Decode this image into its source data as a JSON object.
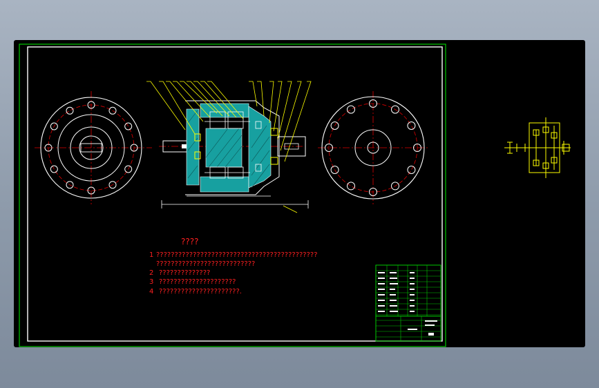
{
  "viewport": {
    "background": "#000000",
    "frame_color": "#00c800",
    "outer_frame_color": "#ffffff"
  },
  "colors": {
    "outline": "#ffffff",
    "centerline": "#e00000",
    "leader": "#ffff00",
    "section_fill": "#17a0a0",
    "notes": "#ff2020",
    "title_block": "#00c800",
    "yellow": "#ffff00"
  },
  "technical_requirements": {
    "heading": "????",
    "items": [
      {
        "num": "1",
        "text": "????????????????????????????????????????????"
      },
      {
        "num": "",
        "text": "???????????????????????????"
      },
      {
        "num": "2",
        "text": "??????????????"
      },
      {
        "num": "3",
        "text": "?????????????????????"
      },
      {
        "num": "4",
        "text": "??????????????????????."
      }
    ]
  }
}
